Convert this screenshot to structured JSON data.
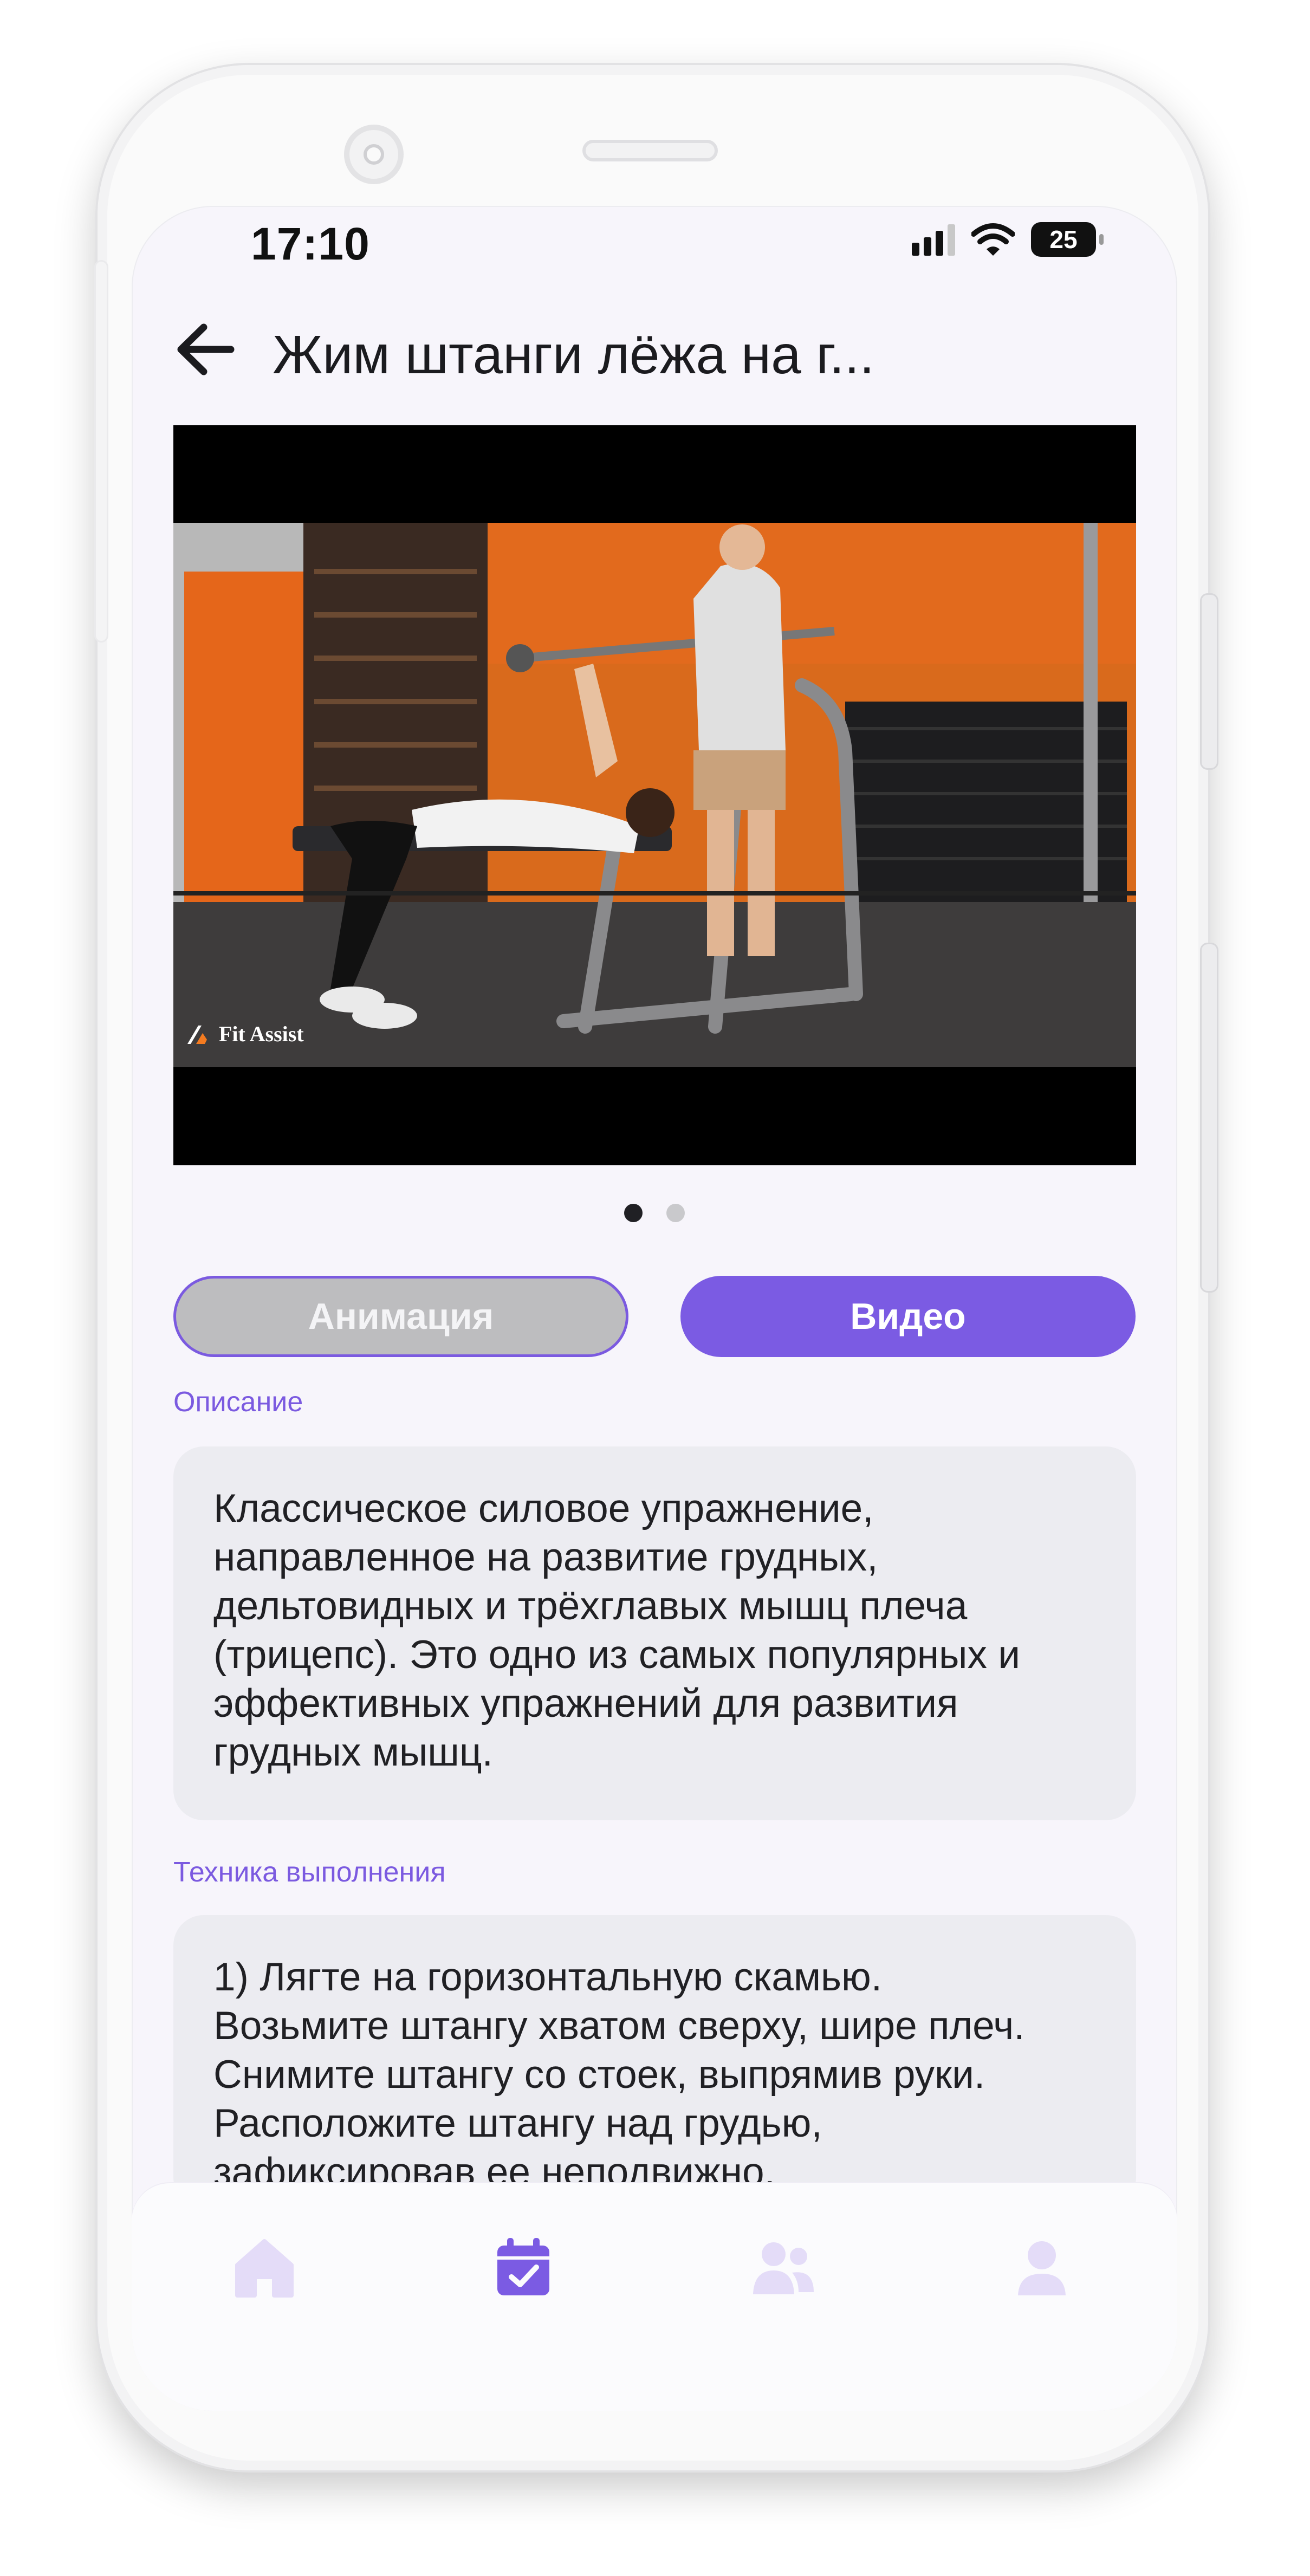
{
  "status_bar": {
    "time": "17:10",
    "battery": "25"
  },
  "header": {
    "title": "Жим штанги лёжа на г..."
  },
  "media": {
    "watermark": "Fit Assist",
    "slide_count": 2,
    "active_slide": 1
  },
  "toggle": {
    "animation_label": "Анимация",
    "video_label": "Видео",
    "selected": "Видео"
  },
  "description": {
    "label": "Описание",
    "text_lines": [
      "Классическое силовое упражнение,",
      "направленное на развитие грудных,",
      "дельтовидных и трёхглавых мышц плеча",
      "(трицепс). Это одно из самых популярных и",
      "эффективных упражнений для развития",
      "грудных мышц."
    ]
  },
  "technique": {
    "label": "Техника выполнения",
    "text_lines": [
      "1) Лягте на горизонтальную скамью.",
      "Возьмите штангу хватом сверху, шире плеч.",
      "Снимите штангу со стоек, выпрямив руки.",
      "Расположите штангу над грудью,",
      "зафиксировав ее неподвижно."
    ]
  },
  "tab_bar": {
    "active": "calendar",
    "items": [
      {
        "id": "home",
        "icon": "home-icon"
      },
      {
        "id": "calendar",
        "icon": "calendar-check-icon"
      },
      {
        "id": "community",
        "icon": "users-icon"
      },
      {
        "id": "profile",
        "icon": "profile-icon"
      }
    ]
  },
  "colors": {
    "accent": "#7b5be3",
    "inactive_icon": "#e4dcf8",
    "card_bg": "#ececf1",
    "screen_bg": "#f7f5fb"
  }
}
